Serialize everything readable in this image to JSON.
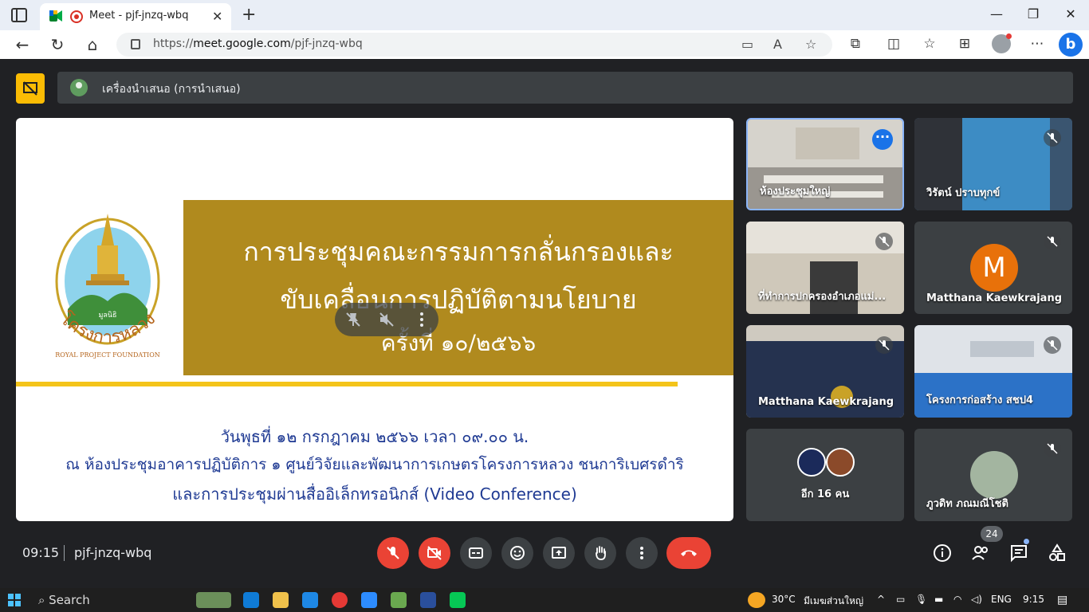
{
  "browser": {
    "tab_title": "Meet - pjf-jnzq-wbq",
    "url_prefix": "https://",
    "url_domain": "meet.google.com",
    "url_path": "/pjf-jnzq-wbq"
  },
  "meet": {
    "presenter_label": "เครื่องนำเสนอ (การนำเสนอ)",
    "slide": {
      "title_line1": "การประชุมคณะกรรมการกลั่นกรองและ",
      "title_line2": "ขับเคลื่อนการปฏิบัติตามนโยบาย",
      "title_line3": "ครั้งที่ ๑๐/๒๕๖๖",
      "detail_line1": "วันพุธที่ ๑๒ กรกฎาคม ๒๕๖๖ เวลา ๐๙.๐๐ น.",
      "detail_line2": "ณ ห้องประชุมอาคารปฏิบัติการ ๑ ศูนย์วิจัยและพัฒนาการเกษตรโครงการหลวง ชนการิเบศรดำริ",
      "detail_line3": "และการประชุมผ่านสื่ออิเล็กทรอนิกส์ (Video Conference)",
      "logo_top_text": "มูลนิธิ",
      "logo_arc_text": "โครงการหลวง",
      "logo_sub_text": "ROYAL PROJECT FOUNDATION"
    },
    "participants": [
      {
        "name": "ห้องประชุมใหญ่"
      },
      {
        "name": "วิรัตน์ ปราบทุกข์"
      },
      {
        "name": "ที่ทำการปกครองอำเภอแม่..."
      },
      {
        "name": "Matthana Kaewkrajang",
        "initial": "M"
      },
      {
        "name": "Matthana Kaewkrajang"
      },
      {
        "name": "โครงการก่อสร้าง สชป4"
      },
      {
        "name": "อีก 16 คน"
      },
      {
        "name": "ภูวดิท ภณมณีโชติ"
      }
    ],
    "clock": "09:15",
    "meeting_code": "pjf-jnzq-wbq",
    "people_count": "24"
  },
  "taskbar": {
    "search_label": "Search",
    "weather": "30°C",
    "weather_desc": "มีเมฆส่วนใหญ่",
    "lang": "ENG",
    "time": "9:15"
  }
}
